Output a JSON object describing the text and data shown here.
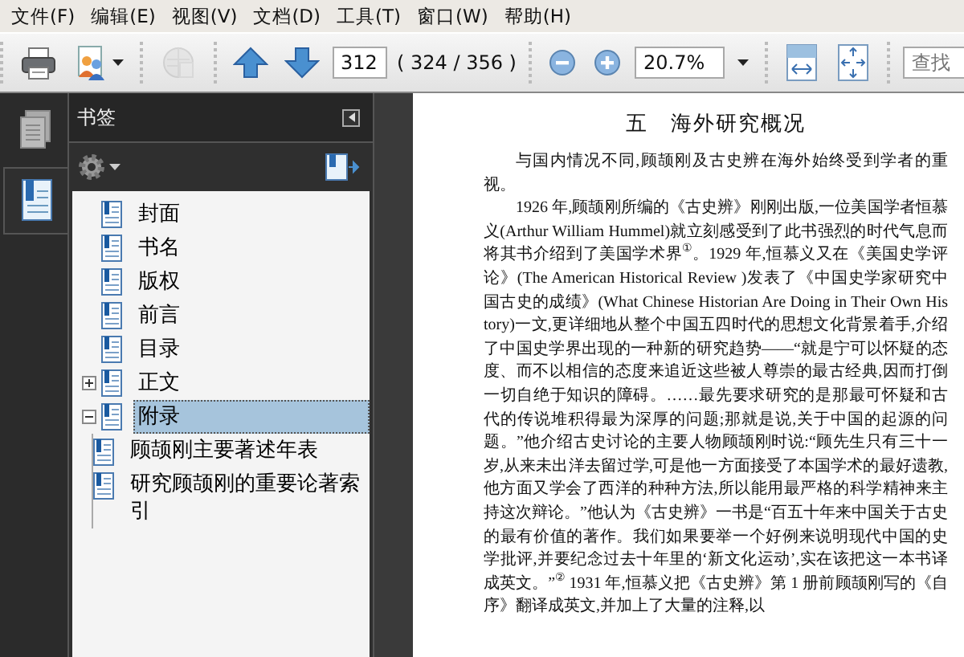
{
  "menu": [
    "文件(F)",
    "编辑(E)",
    "视图(V)",
    "文档(D)",
    "工具(T)",
    "窗口(W)",
    "帮助(H)"
  ],
  "toolbar": {
    "groups": [
      [
        {
          "kind": "print",
          "disabled": false
        },
        {
          "kind": "share",
          "disabled": false
        }
      ],
      [
        {
          "kind": "globe",
          "disabled": true
        }
      ],
      [
        {
          "kind": "up",
          "disabled": false
        },
        {
          "kind": "down",
          "disabled": false
        },
        {
          "kind": "page_field",
          "value": "312"
        },
        {
          "kind": "page_count",
          "text": "( 324 / 356 )"
        }
      ],
      [
        {
          "kind": "zoom_out",
          "disabled": false
        },
        {
          "kind": "zoom_in",
          "disabled": false
        },
        {
          "kind": "zoom_field",
          "value": "20.7%"
        }
      ],
      [
        {
          "kind": "fit_width",
          "disabled": false
        },
        {
          "kind": "fit_page",
          "disabled": false
        }
      ],
      [
        {
          "kind": "search",
          "placeholder": "查找"
        }
      ]
    ]
  },
  "sidebar": {
    "tabs": [
      {
        "kind": "pages",
        "selected": false
      },
      {
        "kind": "bookmarks",
        "selected": true
      }
    ]
  },
  "bookmarks": {
    "title": "书签",
    "items": [
      {
        "label": "封面",
        "selected": false
      },
      {
        "label": "书名",
        "selected": false
      },
      {
        "label": "版权",
        "selected": false
      },
      {
        "label": "前言",
        "selected": false
      },
      {
        "label": "目录",
        "selected": false
      },
      {
        "label": "正文",
        "selected": false,
        "expanded": false
      },
      {
        "label": "附录",
        "selected": true,
        "expanded": true,
        "children": [
          {
            "label": "顾颉刚主要著述年表",
            "selected": false
          },
          {
            "label": "研究顾颉刚的重要论著索引",
            "selected": false
          }
        ]
      }
    ]
  },
  "document": {
    "title": "五　海外研究概况",
    "paragraphs": [
      "与国内情况不同,顾颉刚及古史辨在海外始终受到学者的重视。",
      "1926 年,顾颉刚所编的《古史辨》刚刚出版,一位美国学者恒慕义(Arthur William Hummel)就立刻感受到了此书强烈的时代气息而将其书介绍到了美国学术界$^{①}$。1929 年,恒慕义又在《美国史学评论》(The American Historical Review )发表了《中国史学家研究中国古史的成绩》(What Chinese Historian Are Doing in Their Own History)一文,更详细地从整个中国五四时代的思想文化背景着手,介绍了中国史学界出现的一种新的研究趋势——“就是宁可以怀疑的态度、而不以相信的态度来追近这些被人尊崇的最古经典,因而打倒一切自绝于知识的障碍。……最先要求研究的是那最可怀疑和古代的传说堆积得最为深厚的问题;那就是说,关于中国的起源的问题。”他介绍古史讨论的主要人物顾颉刚时说:“顾先生只有三十一岁,从来未出洋去留过学,可是他一方面接受了本国学术的最好遗教,他方面又学会了西洋的种种方法,所以能用最严格的科学精神来主持这次辩论。”他认为《古史辨》一书是“百五十年来中国关于古史的最有价值的著作。我们如果要举一个好例来说明现代中国的史学批评,并要纪念过去十年里的‘新文化运动’,实在该把这一本书译成英文。”$^{②}$ 1931 年,恒慕义把《古史辨》第 1 册前顾颉刚写的《自序》翻译成英文,并加上了大量的注释,以"
    ]
  }
}
